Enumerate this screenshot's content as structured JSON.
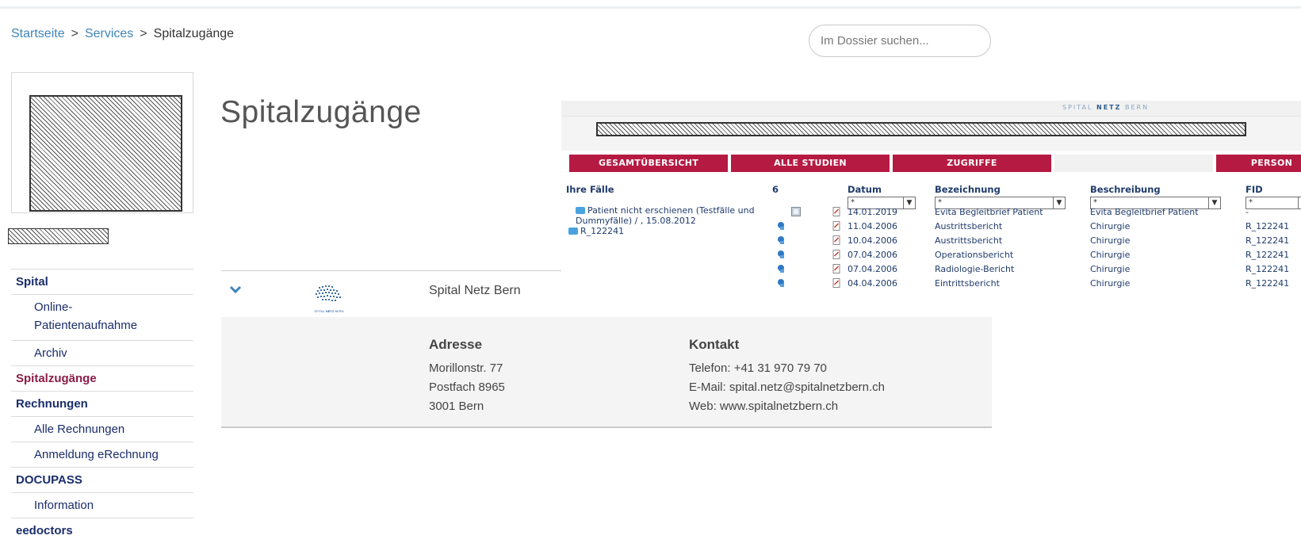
{
  "breadcrumb": {
    "items": [
      "Startseite",
      "Services"
    ],
    "separator": ">",
    "current": "Spitalzugänge"
  },
  "search": {
    "placeholder": "Im Dossier suchen..."
  },
  "sidebar": {
    "items": [
      {
        "label": "Spital",
        "kind": "section"
      },
      {
        "label": "Online-Patientenaufnahme",
        "kind": "sub",
        "line1": "Online-",
        "line2": "Patientenaufnahme"
      },
      {
        "label": "Archiv",
        "kind": "sub"
      },
      {
        "label": "Spitalzugänge",
        "kind": "active"
      },
      {
        "label": "Rechnungen",
        "kind": "section"
      },
      {
        "label": "Alle Rechnungen",
        "kind": "sub"
      },
      {
        "label": "Anmeldung eRechnung",
        "kind": "sub"
      },
      {
        "label": "DOCUPASS",
        "kind": "section"
      },
      {
        "label": "Information",
        "kind": "sub"
      },
      {
        "label": "eedoctors",
        "kind": "section"
      }
    ]
  },
  "main": {
    "title": "Spitalzugänge",
    "provider": {
      "name": "Spital Netz Bern",
      "address_heading": "Adresse",
      "address_lines": [
        "Morillonstr. 77",
        "Postfach 8965",
        "3001 Bern"
      ],
      "contact_heading": "Kontakt",
      "contact_lines": [
        "Telefon: +41 31 970 79 70",
        "E-Mail: spital.netz@spitalnetzbern.ch",
        "Web: www.spitalnetzbern.ch"
      ]
    }
  },
  "portal": {
    "brand_light_1": "SPITAL",
    "brand_strong": "NETZ",
    "brand_light_2": "BERN",
    "tabs": [
      "GESAMTÜBERSICHT",
      "ALLE STUDIEN",
      "ZUGRIFFE",
      "",
      "PERSON"
    ],
    "headers": {
      "cases": "Ihre Fälle",
      "count": "6",
      "date": "Datum",
      "name": "Bezeichnung",
      "description": "Beschreibung",
      "fid": "FID"
    },
    "filter_value": "*",
    "cases": {
      "case1_line1": "Patient nicht erschienen (Testfälle und",
      "case1_line2": "Dummyfälle) / , 15.08.2012",
      "case2": "R_122241"
    },
    "rows": [
      {
        "date": "14.01.2019",
        "name": "Evita Begleitbrief Patient",
        "description": "Evita Begleitbrief Patient",
        "fid": "-"
      },
      {
        "date": "11.04.2006",
        "name": "Austrittsbericht",
        "description": "Chirurgie",
        "fid": "R_122241"
      },
      {
        "date": "10.04.2006",
        "name": "Austrittsbericht",
        "description": "Chirurgie",
        "fid": "R_122241"
      },
      {
        "date": "07.04.2006",
        "name": "Operationsbericht",
        "description": "Chirurgie",
        "fid": "R_122241"
      },
      {
        "date": "07.04.2006",
        "name": "Radiologie-Bericht",
        "description": "Chirurgie",
        "fid": "R_122241"
      },
      {
        "date": "04.04.2006",
        "name": "Eintrittsbericht",
        "description": "Chirurgie",
        "fid": "R_122241"
      }
    ]
  },
  "icons": {
    "chevron": "chevron-down-icon",
    "folder": "folder-icon",
    "document": "document-icon",
    "preview": "preview-icon",
    "share": "share-icon"
  },
  "colors": {
    "link": "#3f84b9",
    "nav_text": "#1a2d6b",
    "active": "#8c1c47",
    "tab_red": "#b51a42",
    "portal_text": "#1f3b6b"
  }
}
